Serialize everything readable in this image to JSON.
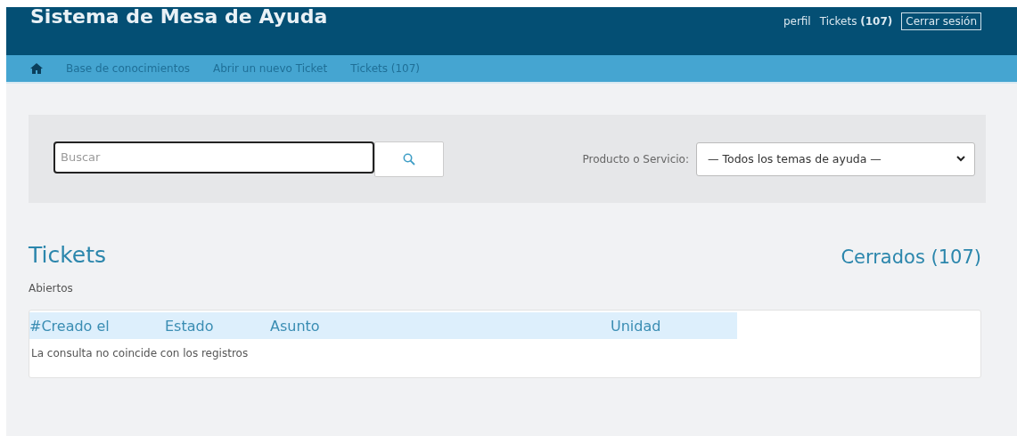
{
  "header": {
    "title": "Sistema de Mesa de Ayuda",
    "links": [
      {
        "kind": "link",
        "label": "perfil"
      },
      {
        "kind": "link",
        "label": "Tickets **(107)**"
      },
      {
        "kind": "outlined",
        "label": "Cerrar sesión"
      }
    ]
  },
  "nav": {
    "items": [
      "Base de conocimientos",
      "Abrir un nuevo Ticket",
      "Tickets (107)"
    ]
  },
  "search": {
    "placeholder": "Buscar",
    "filter_label": "Producto o Servicio:",
    "filter_value": "— Todos los temas de ayuda —"
  },
  "tickets": {
    "title": "Tickets",
    "closed_link": "Cerrados (107)",
    "open_label": "Abiertos",
    "columns": [
      "#Creado el",
      "Estado",
      "Asunto",
      "Unidad"
    ],
    "empty_message": "La consulta no coincide con los registros"
  }
}
